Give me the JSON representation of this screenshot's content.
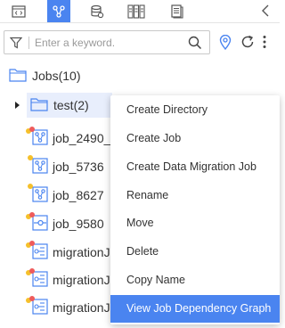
{
  "tabs": [
    {
      "icon": "code-icon",
      "active": false
    },
    {
      "icon": "workflow-icon",
      "active": true
    },
    {
      "icon": "database-icon",
      "active": false
    },
    {
      "icon": "table-icon",
      "active": false
    },
    {
      "icon": "document-icon",
      "active": false
    }
  ],
  "search": {
    "placeholder": "Enter a keyword.",
    "value": ""
  },
  "tree": {
    "root_label": "Jobs",
    "root_count": "(10)",
    "folder_label": "test",
    "folder_count": "(2)",
    "jobs": [
      {
        "label": "job_2490_",
        "status": [
          "red",
          "yellow"
        ],
        "kind": "workflow"
      },
      {
        "label": "job_5736",
        "status": [
          "yellow"
        ],
        "kind": "workflow"
      },
      {
        "label": "job_8627",
        "status": [
          "yellow"
        ],
        "kind": "workflow"
      },
      {
        "label": "job_9580",
        "status": [
          "red",
          "yellow"
        ],
        "kind": "single"
      },
      {
        "label": "migrationJo",
        "status": [
          "red",
          "yellow"
        ],
        "kind": "migration"
      },
      {
        "label": "migrationJo",
        "status": [
          "red",
          "yellow"
        ],
        "kind": "migration"
      },
      {
        "label": "migrationJo",
        "status": [
          "red",
          "yellow"
        ],
        "kind": "migration"
      }
    ]
  },
  "context_menu": {
    "items": [
      "Create Directory",
      "Create Job",
      "Create Data Migration Job",
      "Rename",
      "Move",
      "Delete",
      "Copy Name",
      "View Job Dependency Graph"
    ],
    "highlighted_index": 7
  },
  "colors": {
    "accent": "#4a84f0",
    "status_red": "#ef5b5b",
    "status_yellow": "#f5c02b",
    "icon_blue": "#4a84f0"
  }
}
